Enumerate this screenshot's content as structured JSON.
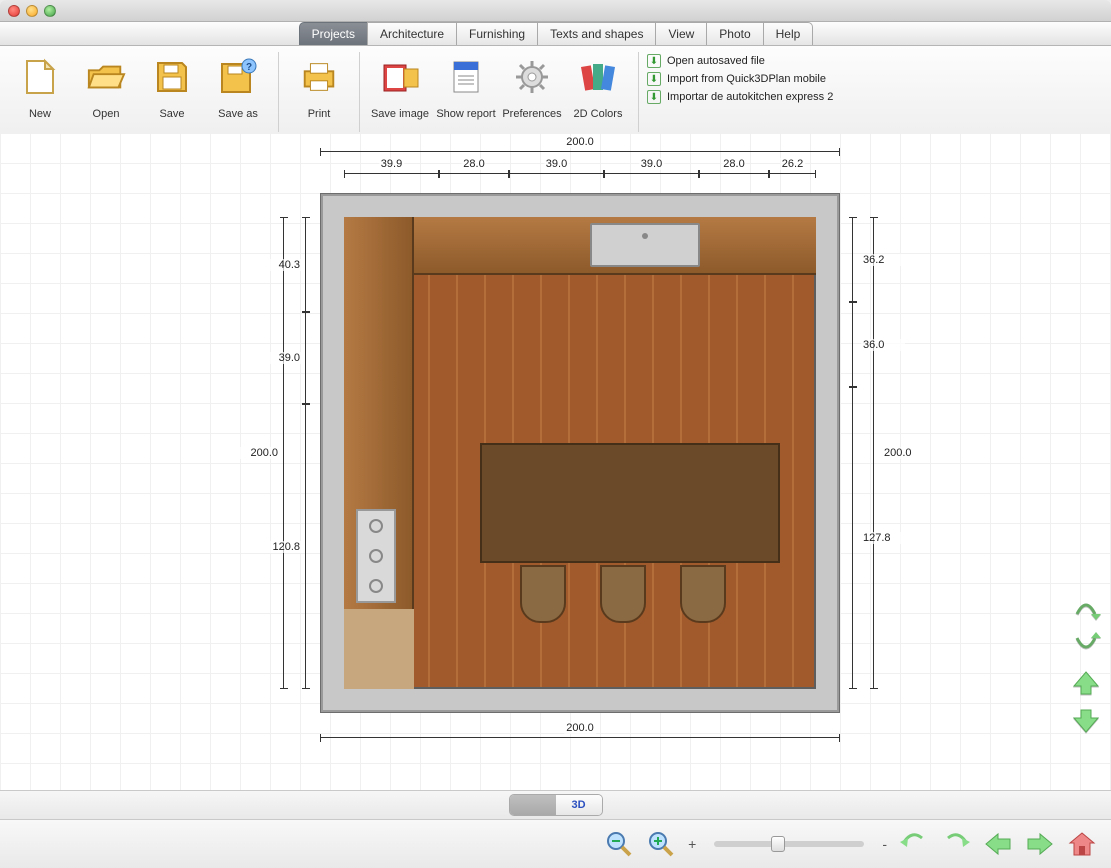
{
  "tabs": {
    "items": [
      "Projects",
      "Architecture",
      "Furnishing",
      "Texts and shapes",
      "View",
      "Photo",
      "Help"
    ],
    "active_index": 0
  },
  "ribbon": {
    "tools": {
      "new": "New",
      "open": "Open",
      "save": "Save",
      "save_as": "Save as",
      "print": "Print",
      "save_image": "Save image",
      "show_report": "Show report",
      "preferences": "Preferences",
      "colors_2d": "2D Colors"
    },
    "links": {
      "open_autosaved": "Open autosaved file",
      "import_mobile": "Import from Quick3DPlan mobile",
      "import_autokitchen": "Importar de autokitchen express 2"
    }
  },
  "dimensions": {
    "top_overall": "200.0",
    "top_segments": [
      "39.9",
      "28.0",
      "39.0",
      "39.0",
      "28.0",
      "26.2"
    ],
    "bottom_overall": "200.0",
    "left_overall": "200.0",
    "left_segments": [
      "40.3",
      "39.0",
      "120.8"
    ],
    "right_overall": "200.0",
    "right_segments": [
      "36.2",
      "36.0",
      "127.8"
    ]
  },
  "view_toggle": {
    "mode_2d": "",
    "mode_3d": "3D"
  },
  "zoom": {
    "plus": "+",
    "minus": "-"
  }
}
